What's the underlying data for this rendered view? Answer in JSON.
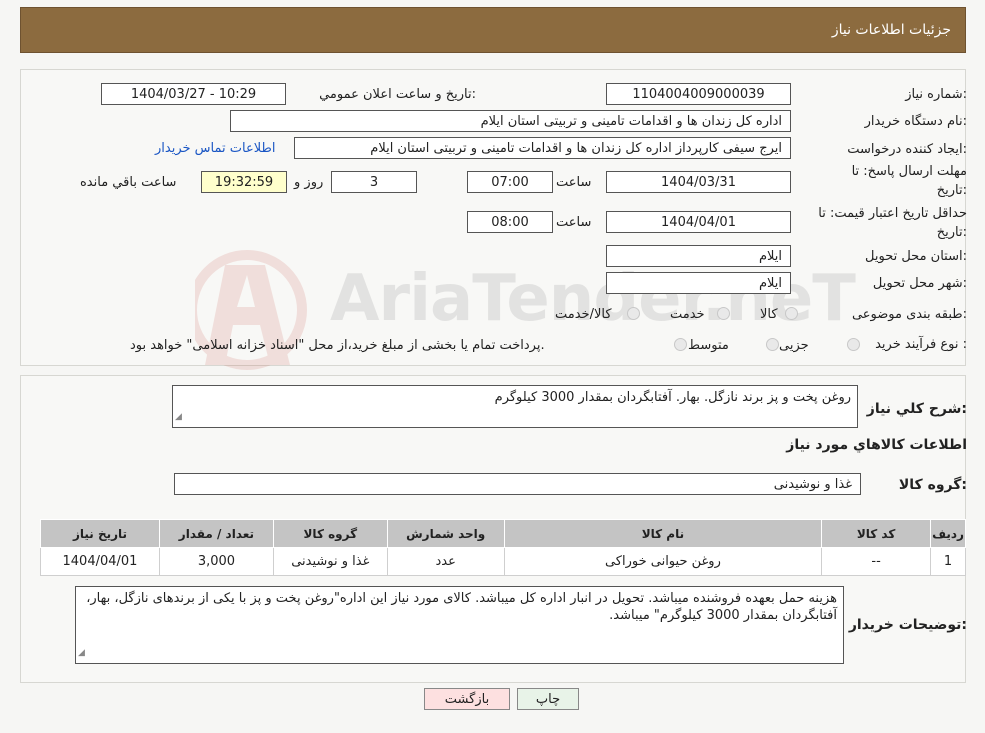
{
  "header": {
    "title": "جزئیات اطلاعات نیاز"
  },
  "form": {
    "need_number_label": "شماره نیاز:",
    "need_number": "1104004009000039",
    "announce_label": "تاریخ و ساعت اعلان عمومي:",
    "announce_value": "1404/03/27 - 10:29",
    "buyer_org_label": "نام دستگاه خریدار:",
    "buyer_org": "اداره کل زندان ها و اقدامات تامینی و تربیتی استان ایلام",
    "creator_label": "ایجاد کننده درخواست:",
    "creator": "ایرج  سیفی کارپرداز اداره کل زندان ها و اقدامات تامینی و تربیتی استان ایلام",
    "contact_link": "اطلاعات تماس خریدار",
    "deadline_label_1": "مهلت ارسال پاسخ: تا",
    "deadline_label_2": "تاریخ:",
    "deadline_date": "1404/03/31",
    "time_label": "ساعت",
    "deadline_time": "07:00",
    "days_value": "3",
    "days_label": "روز و",
    "remaining_time": "19:32:59",
    "remaining_label": "ساعت باقي مانده",
    "validity_label_1": "حداقل تاریخ اعتبار قیمت: تا",
    "validity_label_2": "تاریخ:",
    "validity_date": "1404/04/01",
    "validity_time": "08:00",
    "province_label": "استان محل تحویل:",
    "province": "ایلام",
    "city_label": "شهر محل تحویل:",
    "city": "ایلام",
    "category_label": "طبقه بندی موضوعی:",
    "category_options": [
      "کالا",
      "خدمت",
      "کالا/خدمت"
    ],
    "process_label": "نوع فرآیند خرید :",
    "process_options": [
      "جزیی",
      "متوسط"
    ],
    "process_note": "پرداخت تمام یا بخشی از مبلغ خرید،از محل \"اسناد خزانه اسلامی\" خواهد بود."
  },
  "details": {
    "summary_label": "شرح کلي نیاز:",
    "summary": "روغن پخت و پز برند نازگل. بهار. آفتابگردان بمقدار 3000 کیلوگرم",
    "goods_heading": "اطلاعات کالاهاي مورد نیاز",
    "goods_group_label": "گروه کالا:",
    "goods_group": "غذا و نوشیدنی",
    "table": {
      "headers": [
        "ردیف",
        "کد کالا",
        "نام کالا",
        "واحد شمارش",
        "گروه کالا",
        "تعداد / مقدار",
        "تاریخ نیاز"
      ],
      "rows": [
        [
          "1",
          "--",
          "روغن حیوانی خوراکی",
          "عدد",
          "غذا و نوشیدنی",
          "3,000",
          "1404/04/01"
        ]
      ]
    },
    "buyer_notes_label": "توضیحات خریدار:",
    "buyer_notes": "هزینه حمل بعهده فروشنده میباشد. تحویل در انبار اداره کل میباشد. کالای مورد نیاز این اداره\"روغن پخت و پز با یکی از برندهای نازگل، بهار، آفتابگردان بمقدار 3000 کیلوگرم\" میباشد."
  },
  "buttons": {
    "print": "چاپ",
    "back": "بازگشت"
  },
  "watermark": {
    "text": "AriaTender.neT"
  },
  "colors": {
    "header_bg": "#8c6b3f",
    "link": "#1a56c4",
    "back_button": "#fde0e0",
    "print_button": "#e8f3e8"
  }
}
